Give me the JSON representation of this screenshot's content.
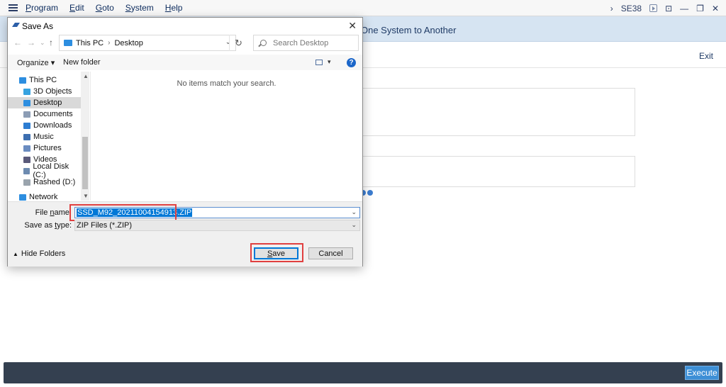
{
  "sap": {
    "menu": [
      {
        "first": "P",
        "rest": "rogram"
      },
      {
        "first": "E",
        "rest": "dit"
      },
      {
        "first": "G",
        "rest": "oto"
      },
      {
        "first": "S",
        "rest": "ystem"
      },
      {
        "first": "H",
        "rest": "elp"
      }
    ],
    "tcode": "SE38",
    "title_fragment": "One System to Another",
    "exit_label": "Exit",
    "execute_label": "Execute"
  },
  "dialog": {
    "title": "Save As",
    "close_glyph": "✕",
    "address": {
      "root": "This PC",
      "folder": "Desktop"
    },
    "search_placeholder": "Search Desktop",
    "toolbar": {
      "organize": "Organize ▾",
      "new_folder": "New folder"
    },
    "help_glyph": "?",
    "nav_items": [
      {
        "label": "This PC",
        "icon": "computer-icon",
        "color": "#2d8ee0"
      },
      {
        "label": "3D Objects",
        "icon": "cube-icon",
        "color": "#37a3e0"
      },
      {
        "label": "Desktop",
        "icon": "desktop-icon",
        "color": "#2d8ee0"
      },
      {
        "label": "Documents",
        "icon": "document-icon",
        "color": "#8c9db5"
      },
      {
        "label": "Downloads",
        "icon": "download-icon",
        "color": "#2d7dd2"
      },
      {
        "label": "Music",
        "icon": "music-icon",
        "color": "#3d6fb0"
      },
      {
        "label": "Pictures",
        "icon": "picture-icon",
        "color": "#6a8cc0"
      },
      {
        "label": "Videos",
        "icon": "video-icon",
        "color": "#5a5a7a"
      },
      {
        "label": "Local Disk (C:)",
        "icon": "drive-icon",
        "color": "#6d8bb0"
      },
      {
        "label": "Rashed (D:)",
        "icon": "drive-icon",
        "color": "#9aa4ad"
      },
      {
        "label": "Network",
        "icon": "network-icon",
        "color": "#2d8ee0"
      }
    ],
    "selected_nav": "Desktop",
    "empty_message": "No items match your search.",
    "file_name_label": {
      "pre": "File ",
      "ul": "n",
      "post": "ame:"
    },
    "file_name_value": "SSD_M92_20211004154913.ZIP",
    "save_type_label": {
      "pre": "Save as ",
      "ul": "t",
      "post": "ype:"
    },
    "save_type_value": "ZIP Files (*.ZIP)",
    "hide_folders": "Hide Folders",
    "save_button": {
      "ul": "S",
      "rest": "ave"
    },
    "cancel_button": "Cancel",
    "colors": {
      "accent": "#0078d7",
      "highlight": "#e04040",
      "sap_header": "#d6e4f2",
      "sap_footer": "#344050"
    }
  }
}
